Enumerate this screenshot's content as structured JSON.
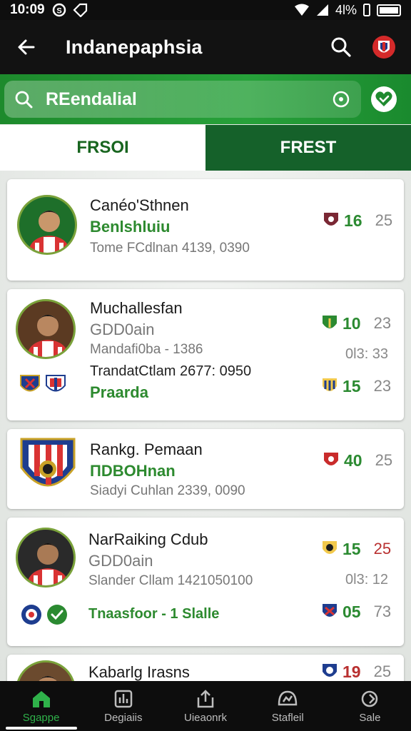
{
  "status_bar": {
    "time": "10:09",
    "right_text": "4l%"
  },
  "app_bar": {
    "title": "Indanepaphsia"
  },
  "search": {
    "value": "REendalial"
  },
  "tabs": [
    {
      "label": "FRSOI",
      "active": true
    },
    {
      "label": "FREST",
      "active": false
    }
  ],
  "cards": [
    {
      "title": "Canéo'Sthnen",
      "subtitle": "Benlshluiu",
      "meta": "Tome FCdlnan 4139, 0390",
      "stat_value": "16",
      "stat_secondary": "25"
    },
    {
      "title": "Muchallesfan",
      "subtitle": "GDD0ain",
      "meta": "Mandafi0ba - 1386",
      "line2": "TrandatCtlam 2677: 0950",
      "line3": "Praarda",
      "stat_value": "10",
      "stat_secondary": "23",
      "meta_right": "0l3: 33",
      "stat2_value": "15",
      "stat2_secondary": "23"
    },
    {
      "title": "Rankg. Pemaan",
      "subtitle": "ПDBOHnan",
      "meta": "Siadyi Cuhlan 2339, 0090",
      "stat_value": "40",
      "stat_secondary": "25"
    },
    {
      "title": "NarRaiking Cdub",
      "subtitle": "GDD0ain",
      "meta": "Slander Cllam 1421050100",
      "line3": "Tnaasfoor - 1 Slalle",
      "stat_value": "15",
      "stat_secondary": "25",
      "meta_right": "0l3: 12",
      "stat2_value": "05",
      "stat2_secondary": "73"
    },
    {
      "title": "Kabarlg Irasns",
      "stat_value": "19",
      "stat_secondary": "25"
    }
  ],
  "bottom_nav": [
    {
      "label": "Sgappe",
      "icon": "home-icon",
      "active": true
    },
    {
      "label": "Degiaiis",
      "icon": "stats-icon",
      "active": false
    },
    {
      "label": "Uieaonrk",
      "icon": "share-icon",
      "active": false
    },
    {
      "label": "Stafleil",
      "icon": "chart-icon",
      "active": false
    },
    {
      "label": "Sale",
      "icon": "refresh-icon",
      "active": false
    }
  ],
  "colors": {
    "brand_green": "#27a13a",
    "dark_green": "#15612a",
    "accent_red": "#b93030"
  }
}
